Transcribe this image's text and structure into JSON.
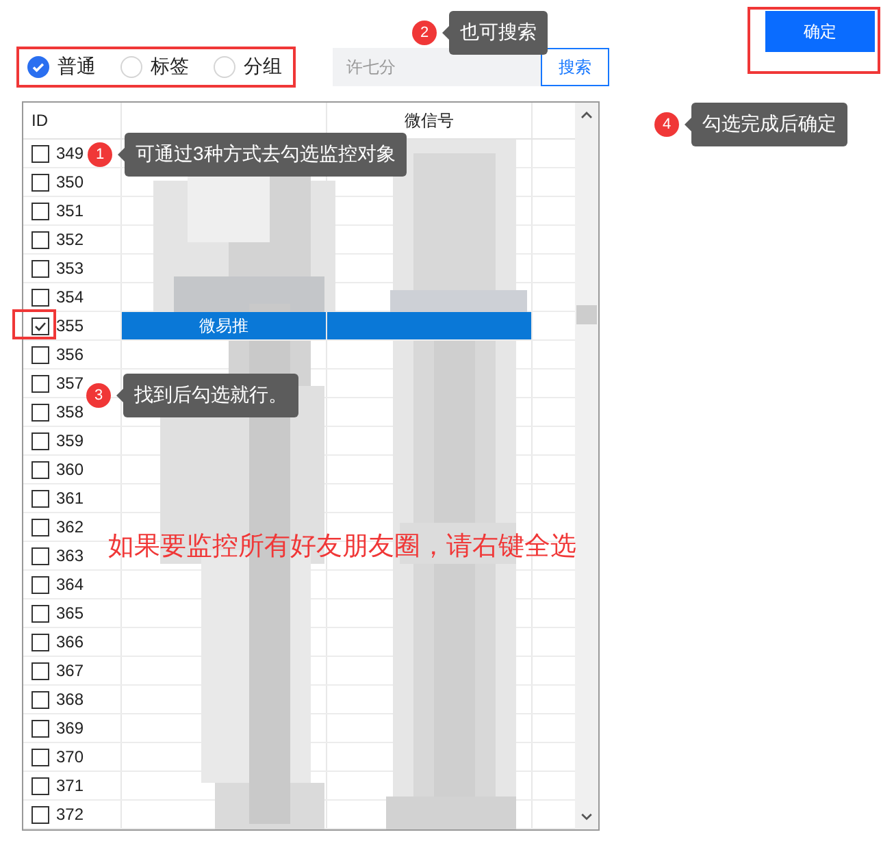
{
  "filter_modes": [
    {
      "label": "普通",
      "selected": true
    },
    {
      "label": "标签",
      "selected": false
    },
    {
      "label": "分组",
      "selected": false
    }
  ],
  "search": {
    "placeholder": "许七分",
    "button": "搜索"
  },
  "confirm_button": "确定",
  "table": {
    "id_header": "ID",
    "column_3_header": "微信号",
    "rows": [
      {
        "id": "349",
        "checked": false,
        "selected": false
      },
      {
        "id": "350",
        "checked": false,
        "selected": false
      },
      {
        "id": "351",
        "checked": false,
        "selected": false
      },
      {
        "id": "352",
        "checked": false,
        "selected": false
      },
      {
        "id": "353",
        "checked": false,
        "selected": false
      },
      {
        "id": "354",
        "checked": false,
        "selected": false
      },
      {
        "id": "355",
        "checked": true,
        "selected": true,
        "column_2": "微易推"
      },
      {
        "id": "356",
        "checked": false,
        "selected": false
      },
      {
        "id": "357",
        "checked": false,
        "selected": false
      },
      {
        "id": "358",
        "checked": false,
        "selected": false
      },
      {
        "id": "359",
        "checked": false,
        "selected": false
      },
      {
        "id": "360",
        "checked": false,
        "selected": false
      },
      {
        "id": "361",
        "checked": false,
        "selected": false
      },
      {
        "id": "362",
        "checked": false,
        "selected": false
      },
      {
        "id": "363",
        "checked": false,
        "selected": false
      },
      {
        "id": "364",
        "checked": false,
        "selected": false
      },
      {
        "id": "365",
        "checked": false,
        "selected": false
      },
      {
        "id": "366",
        "checked": false,
        "selected": false
      },
      {
        "id": "367",
        "checked": false,
        "selected": false
      },
      {
        "id": "368",
        "checked": false,
        "selected": false
      },
      {
        "id": "369",
        "checked": false,
        "selected": false
      },
      {
        "id": "370",
        "checked": false,
        "selected": false
      },
      {
        "id": "371",
        "checked": false,
        "selected": false
      },
      {
        "id": "372",
        "checked": false,
        "selected": false
      }
    ]
  },
  "callouts": [
    {
      "number": "1",
      "text": "可通过3种方式去勾选监控对象"
    },
    {
      "number": "2",
      "text": "也可搜索"
    },
    {
      "number": "3",
      "text": "找到后勾选就行。"
    },
    {
      "number": "4",
      "text": "勾选完成后确定"
    }
  ],
  "note": "如果要监控所有好友朋友圈，请右键全选"
}
